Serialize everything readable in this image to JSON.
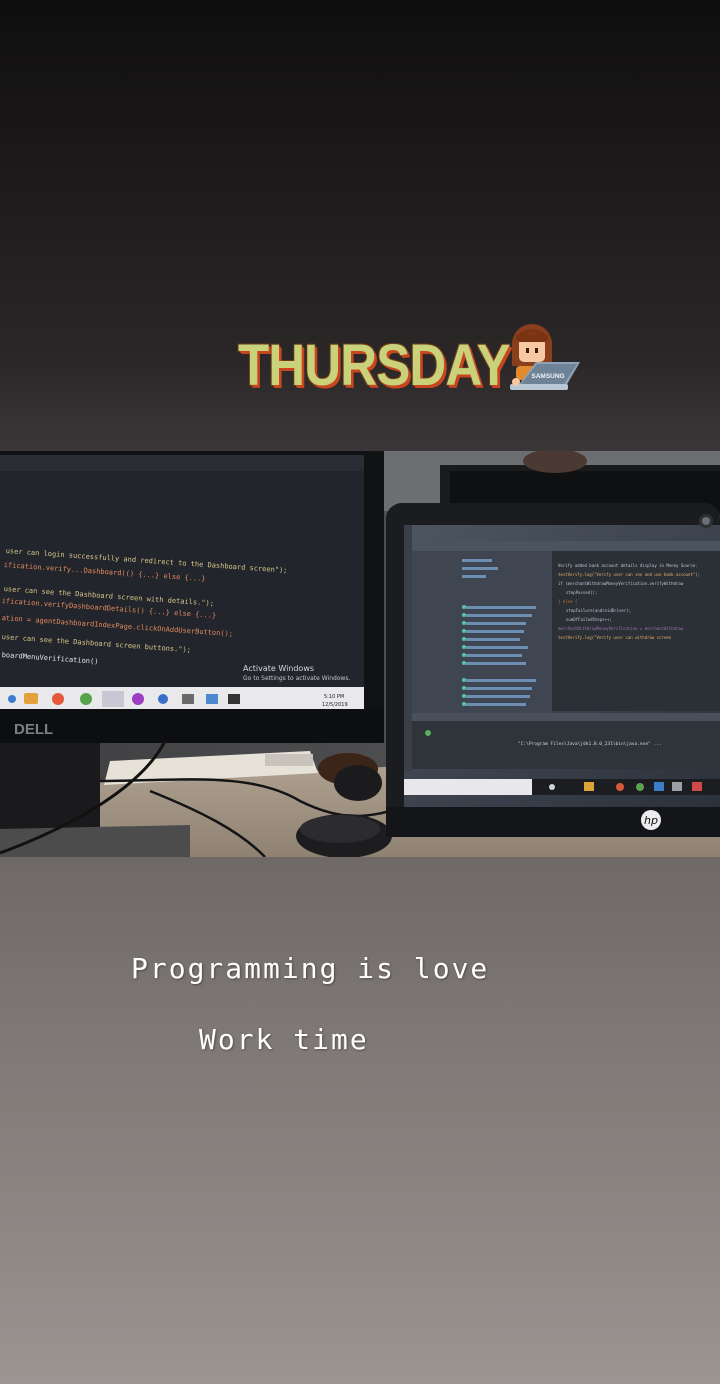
{
  "stickers": {
    "day_label": "THURSDAY",
    "emoji_icon": "woman-technologist-icon",
    "laptop_brand": "SAMSUNG"
  },
  "photo": {
    "activate_windows_title": "Activate Windows",
    "activate_windows_subtitle": "Go to Settings to activate Windows.",
    "left_monitor_brand": "DELL",
    "right_laptop_brand": "hp",
    "code_lines": [
      "user can login successfully and redirect to the Dashboard screen\");",
      "ification.verify...Dashboard(() {...} else {...}",
      "user can see the Dashboard screen with details.\");",
      "ification.verifyDashboardDetails() {...} else {...}",
      "ation = agentDashboardIndexPage.clickOnAddUserButton();",
      "user can see the Dashboard screen buttons.\");",
      "boardMenuVerification()"
    ],
    "ide_editor_lines": [
      "Verify added bank account details display in Money Source.",
      "testVerify.log(\"Verify user can see and use bank account\");",
      "if (merchantWithdrawMoneyVerification.verifyWithdraw",
      "stepPassed();",
      "} else {",
      "stepFailure(androidDriver);",
      "numOfFailedSteps++;",
      "merchantWithdrawMoneyVerification = merchantWithdraw",
      "testVerify.log(\"Verify user can withdraw screen"
    ],
    "terminal_line": "\"C:\\Program Files\\Java\\jdk1.8.0_231\\bin\\java.exe\" ...",
    "taskbar_time": "5:10 PM",
    "taskbar_date": "12/5/2019"
  },
  "captions": {
    "line1": "Programming is love",
    "line2": "Work time"
  },
  "colors": {
    "sticker_fill": "#c9d27a",
    "sticker_shadow": "#c8461e",
    "caption_text": "#ffffff"
  }
}
